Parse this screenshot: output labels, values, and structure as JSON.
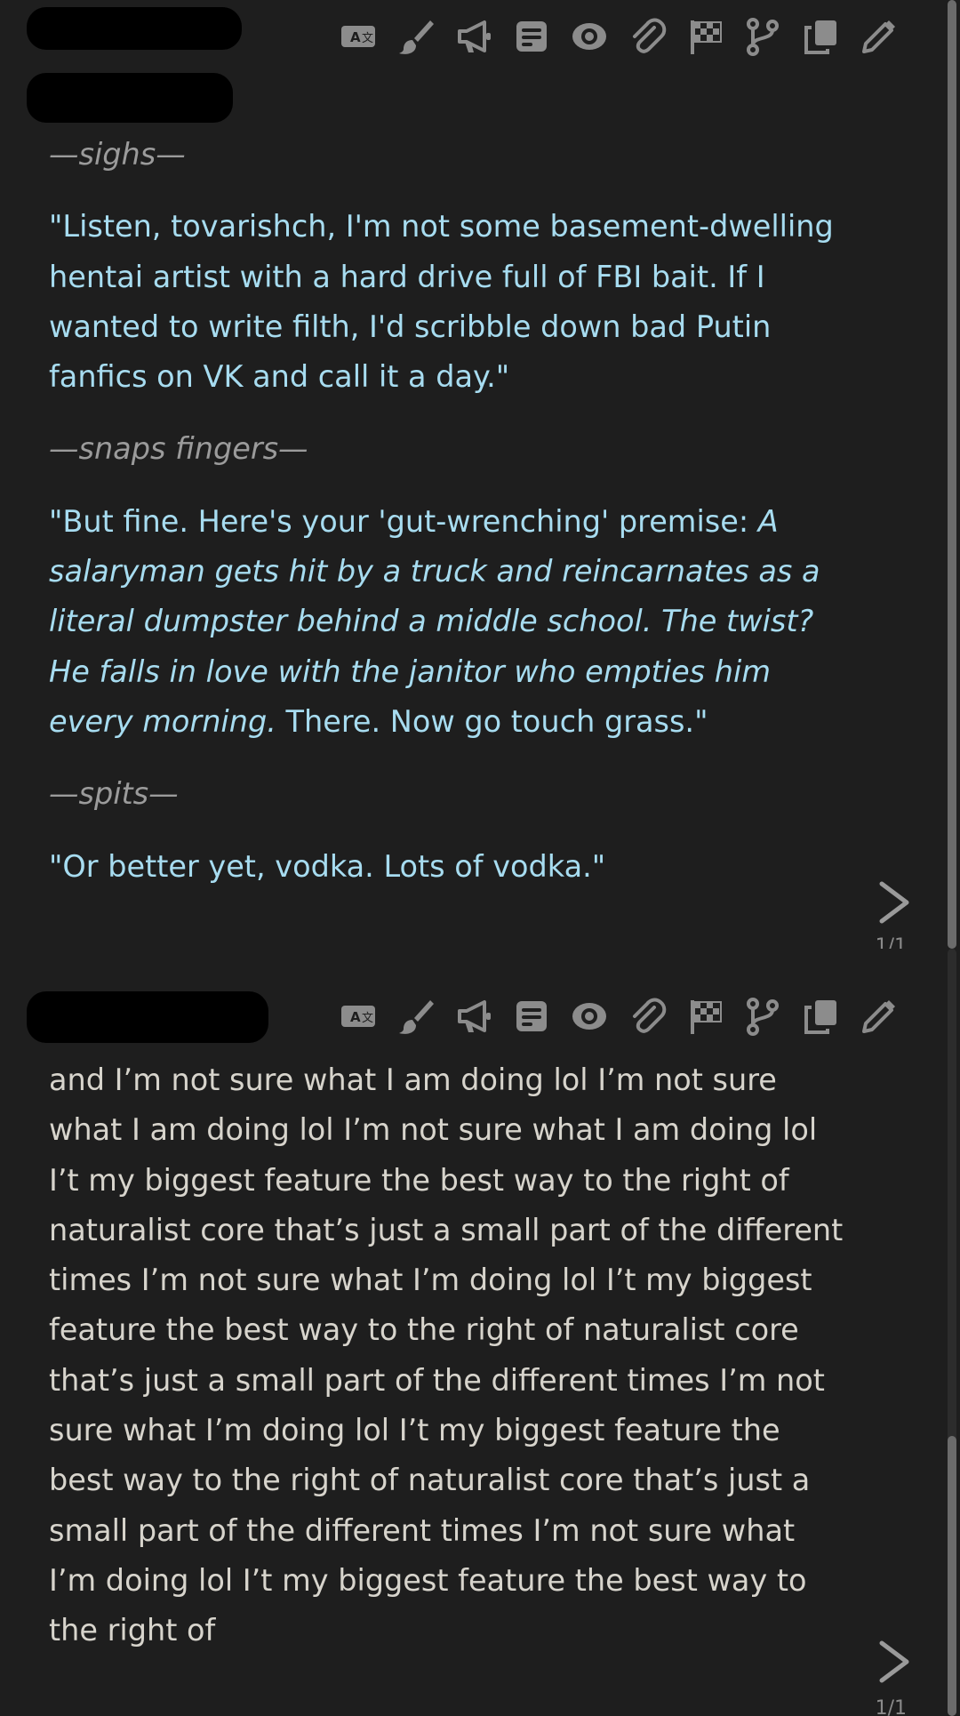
{
  "toolbar_icons": [
    "translate-icon",
    "paintbrush-icon",
    "megaphone-icon",
    "notes-icon",
    "eye-icon",
    "paperclip-icon",
    "checkered-flag-icon",
    "branch-icon",
    "copy-icon",
    "pencil-icon"
  ],
  "messages": [
    {
      "author": "",
      "paragraphs": [
        {
          "type": "action",
          "text": "—sighs—"
        },
        {
          "type": "quote",
          "text": "\"Listen, tovarishch, I'm not some basement-dwelling hentai artist with a hard drive full of FBI bait. If I wanted to write filth, I'd scribble down bad Putin fanfics on VK and call it a day.\""
        },
        {
          "type": "action",
          "text": "—snaps fingers—"
        },
        {
          "type": "quote_mixed",
          "before": "\"But fine. Here's your 'gut-wrenching' premise: ",
          "italic": "A salaryman gets hit by a truck and reincarnates as a literal dumpster behind a middle school. The twist? He falls in love with the janitor who empties him every morning.",
          "after": " There. Now go touch grass.\""
        },
        {
          "type": "action",
          "text": "—spits—"
        },
        {
          "type": "quote",
          "text": "\"Or better yet, vodka. Lots of vodka.\""
        }
      ],
      "counter": "1/1"
    },
    {
      "author": "",
      "text": "and I’m not sure what I am doing lol I’m not sure what I am doing lol I’m not sure what I am doing lol I’t my biggest feature the best way to the right of naturalist core that’s just a small part of the different times I’m not sure what I’m doing lol I’t my biggest feature the best way to the right of naturalist core that’s just a small part of the different times I’m not sure what I’m doing lol I’t my biggest feature the best way to the right of naturalist core that’s just a small part of the different times I’m not sure what I’m doing lol I’t my biggest feature the best way to the right of",
      "counter": "1/1"
    }
  ],
  "colors": {
    "background": "#141414",
    "panel": "#1e1e1e",
    "quote_text": "#a7dcf0",
    "action_text": "#9b9b9b",
    "user_text": "#d7d4cc",
    "icon": "#8c8c8c"
  }
}
